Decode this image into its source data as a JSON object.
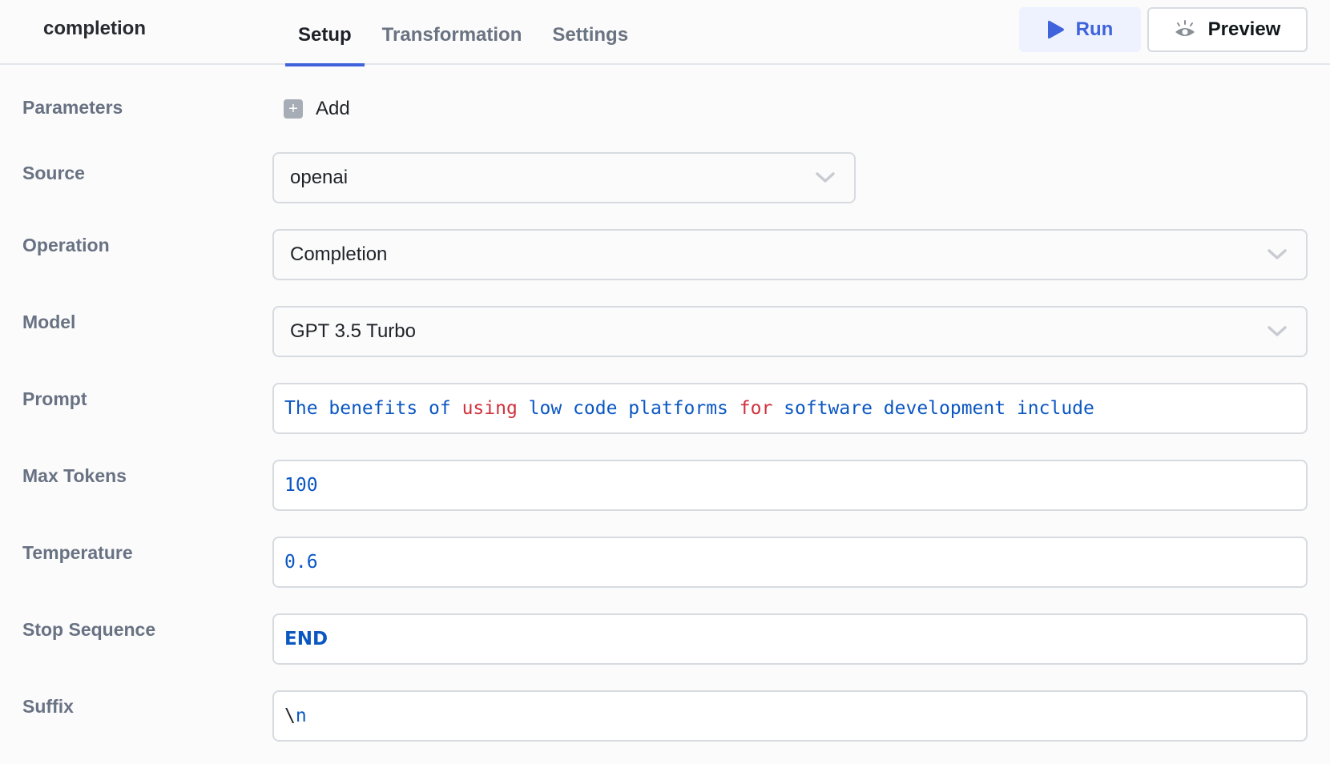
{
  "header": {
    "query_name": "completion",
    "tabs": [
      {
        "label": "Setup",
        "active": true
      },
      {
        "label": "Transformation",
        "active": false
      },
      {
        "label": "Settings",
        "active": false
      }
    ],
    "run_label": "Run",
    "preview_label": "Preview",
    "accent_color": "#3e63dd"
  },
  "form": {
    "parameters": {
      "label": "Parameters",
      "add_label": "Add"
    },
    "source": {
      "label": "Source",
      "value": "openai"
    },
    "operation": {
      "label": "Operation",
      "value": "Completion"
    },
    "model": {
      "label": "Model",
      "value": "GPT 3.5 Turbo"
    },
    "prompt": {
      "label": "Prompt",
      "value": "The benefits of using low code platforms for software development include",
      "tokens": [
        {
          "text": "The benefits of ",
          "kind": "text"
        },
        {
          "text": "using",
          "kind": "keyword"
        },
        {
          "text": " low code platforms ",
          "kind": "text"
        },
        {
          "text": "for",
          "kind": "keyword"
        },
        {
          "text": " software development include",
          "kind": "text"
        }
      ]
    },
    "max_tokens": {
      "label": "Max Tokens",
      "value": "100"
    },
    "temperature": {
      "label": "Temperature",
      "value": "0.6"
    },
    "stop_sequence": {
      "label": "Stop Sequence",
      "value": "END"
    },
    "suffix": {
      "label": "Suffix",
      "value": "\\n",
      "value_escape": "\\",
      "value_char": "n"
    }
  }
}
